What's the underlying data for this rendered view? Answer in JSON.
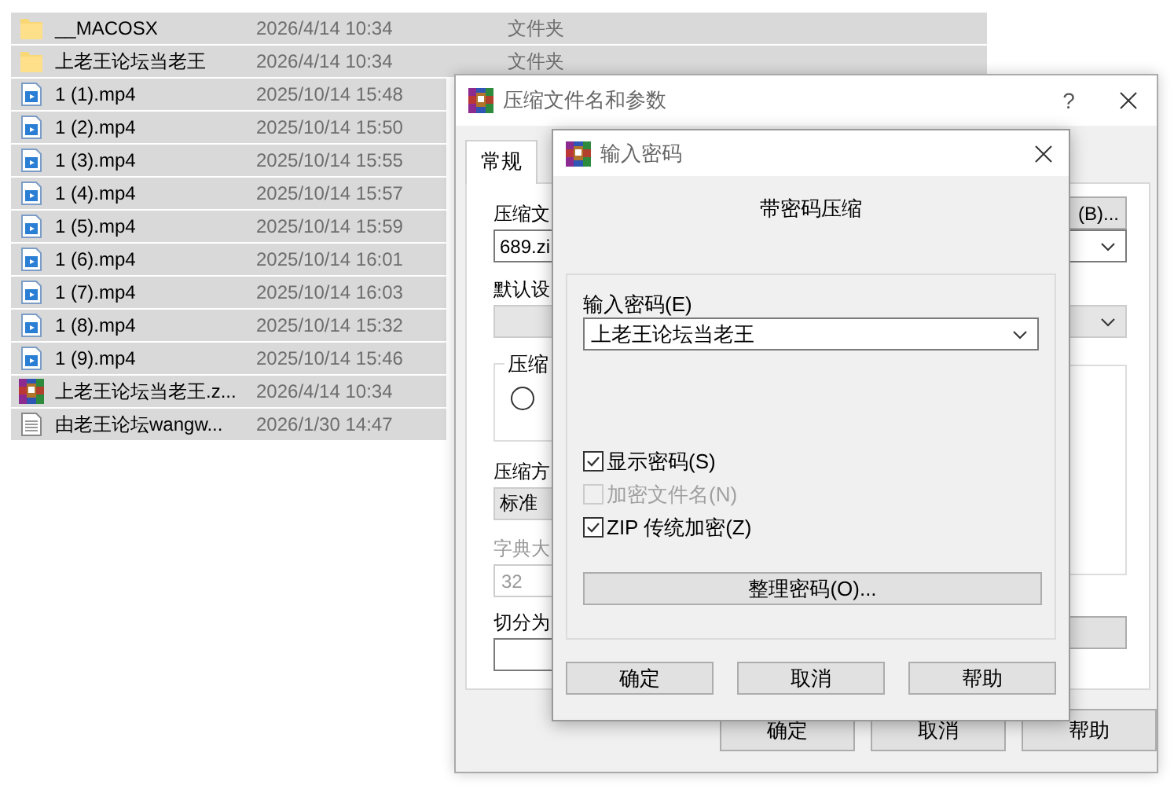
{
  "file_list": {
    "rows": [
      {
        "kind": "folder",
        "name": "__MACOSX",
        "date": "2026/4/14 10:34",
        "type": "文件夹",
        "selected": true
      },
      {
        "kind": "folder",
        "name": "上老王论坛当老王",
        "date": "2026/4/14 10:34",
        "type": "文件夹",
        "selected": true
      },
      {
        "kind": "video",
        "name": "1 (1).mp4",
        "date": "2025/10/14 15:48",
        "selected": true
      },
      {
        "kind": "video",
        "name": "1 (2).mp4",
        "date": "2025/10/14 15:50",
        "selected": true
      },
      {
        "kind": "video",
        "name": "1 (3).mp4",
        "date": "2025/10/14 15:55",
        "selected": true
      },
      {
        "kind": "video",
        "name": "1 (4).mp4",
        "date": "2025/10/14 15:57",
        "selected": true
      },
      {
        "kind": "video",
        "name": "1 (5).mp4",
        "date": "2025/10/14 15:59",
        "selected": true
      },
      {
        "kind": "video",
        "name": "1 (6).mp4",
        "date": "2025/10/14 16:01",
        "selected": true
      },
      {
        "kind": "video",
        "name": "1 (7).mp4",
        "date": "2025/10/14 16:03",
        "selected": true
      },
      {
        "kind": "video",
        "name": "1 (8).mp4",
        "date": "2025/10/14 15:32",
        "selected": true
      },
      {
        "kind": "video",
        "name": "1 (9).mp4",
        "date": "2025/10/14 15:46",
        "selected": true
      },
      {
        "kind": "archive",
        "name": "上老王论坛当老王.z...",
        "date": "2026/4/14 10:34",
        "selected": true
      },
      {
        "kind": "text",
        "name": "由老王论坛wangw...",
        "date": "2026/1/30 14:47",
        "selected": true
      }
    ]
  },
  "archive_dialog": {
    "title": "压缩文件名和参数",
    "help_button": "?",
    "tabs": [
      {
        "label": "常规",
        "selected": true
      }
    ],
    "archive_name_label": "压缩文",
    "browse_button": "(B)...",
    "archive_name": "689.zi",
    "profile_label": "默认设",
    "format_group": "压缩",
    "format_option": {
      "selected": false
    },
    "method_label": "压缩方",
    "method": "标准",
    "dictionary_label": "字典大",
    "dictionary": "32",
    "split_label": "切分为",
    "buttons": [
      "确定",
      "取消",
      "帮助"
    ]
  },
  "password_dialog": {
    "title": "输入密码",
    "heading": "带密码压缩",
    "password_label": "输入密码(E)",
    "password": "上老王论坛当老王",
    "options": [
      {
        "label": "显示密码(S)",
        "checked": true,
        "disabled": false
      },
      {
        "label": "加密文件名(N)",
        "checked": false,
        "disabled": true
      },
      {
        "label": "ZIP 传统加密(Z)",
        "checked": true,
        "disabled": false
      }
    ],
    "organize_button": "整理密码(O)...",
    "buttons": [
      "确定",
      "取消",
      "帮助"
    ]
  }
}
